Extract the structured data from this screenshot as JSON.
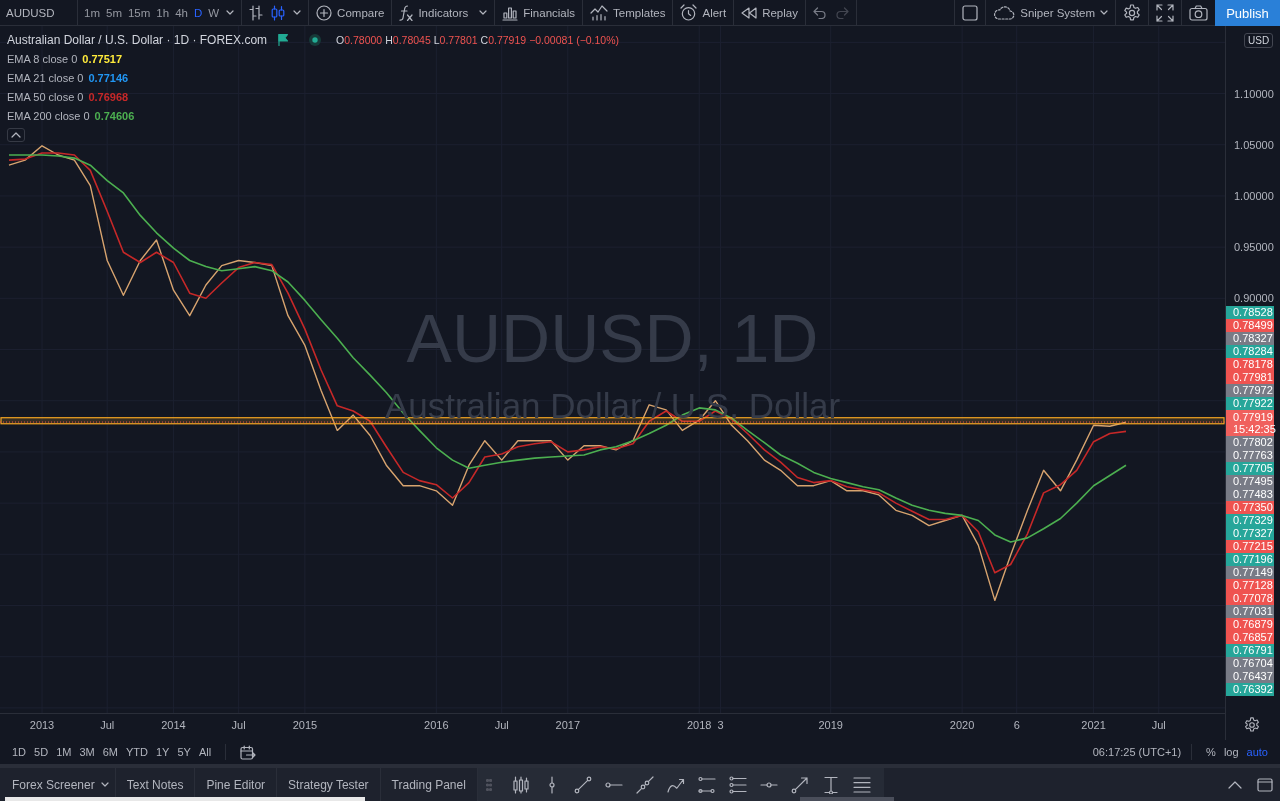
{
  "toolbar": {
    "symbol": "AUDUSD",
    "intervals": [
      {
        "label": "1m",
        "selected": false
      },
      {
        "label": "5m",
        "selected": false
      },
      {
        "label": "15m",
        "selected": false
      },
      {
        "label": "1h",
        "selected": false
      },
      {
        "label": "4h",
        "selected": false
      },
      {
        "label": "D",
        "selected": true
      },
      {
        "label": "W",
        "selected": false
      }
    ],
    "chart_styles": [
      {
        "kind": "bars",
        "selected": false
      },
      {
        "kind": "candles",
        "selected": true
      }
    ],
    "tools": [
      {
        "kind": "compare",
        "label": "Compare",
        "menu": false
      },
      {
        "kind": "indicators",
        "label": "Indicators",
        "menu": true
      },
      {
        "kind": "financials",
        "label": "Financials",
        "menu": false
      },
      {
        "kind": "templates",
        "label": "Templates",
        "menu": false
      },
      {
        "kind": "alert",
        "label": "Alert",
        "menu": false
      },
      {
        "kind": "replay",
        "label": "Replay",
        "menu": false
      }
    ],
    "history": [
      {
        "kind": "undo",
        "disabled": false
      },
      {
        "kind": "redo",
        "disabled": true
      }
    ],
    "layout_name": "Sniper System",
    "publish": "Publish"
  },
  "legend": {
    "title": "Australian Dollar / U.S. Dollar · 1D · FOREX.com",
    "ohlc": [
      {
        "label": "O",
        "value": "0.78000"
      },
      {
        "label": "H",
        "value": "0.78045"
      },
      {
        "label": "L",
        "value": "0.77801"
      },
      {
        "label": "C",
        "value": "0.77919"
      }
    ],
    "change": "−0.00081 (−0.10%)",
    "negative": true,
    "indicators": [
      {
        "label": "EMA 8 close 0",
        "value": "0.77517",
        "color": "#ffeb3b"
      },
      {
        "label": "EMA 21 close 0",
        "value": "0.77146",
        "color": "#2196f3"
      },
      {
        "label": "EMA 50 close 0",
        "value": "0.76968",
        "color": "#c62828"
      },
      {
        "label": "EMA 200 close 0",
        "value": "0.74606",
        "color": "#4caf50"
      }
    ]
  },
  "chart": {
    "watermark": {
      "symbol": "AUDUSD, 1D",
      "description": "Australian Dollar / U.S. Dollar"
    },
    "currency": "USD",
    "chart_data": {
      "type": "line",
      "grid": true,
      "x": [
        "2012-10-01",
        "2012-11-15",
        "2013-01-01",
        "2013-02-15",
        "2013-04-01",
        "2013-05-15",
        "2013-07-01",
        "2013-08-15",
        "2013-10-01",
        "2013-11-15",
        "2014-01-01",
        "2014-02-15",
        "2014-04-01",
        "2014-05-15",
        "2014-07-01",
        "2014-08-15",
        "2014-10-01",
        "2014-11-15",
        "2015-01-01",
        "2015-02-15",
        "2015-04-01",
        "2015-05-15",
        "2015-07-01",
        "2015-08-15",
        "2015-10-01",
        "2015-11-15",
        "2016-01-01",
        "2016-02-15",
        "2016-04-01",
        "2016-05-15",
        "2016-07-01",
        "2016-08-15",
        "2016-10-01",
        "2016-11-15",
        "2017-01-01",
        "2017-02-15",
        "2017-04-01",
        "2017-05-15",
        "2017-07-01",
        "2017-08-15",
        "2017-10-01",
        "2017-11-15",
        "2018-01-01",
        "2018-02-15",
        "2018-04-01",
        "2018-05-15",
        "2018-07-01",
        "2018-08-15",
        "2018-10-01",
        "2018-11-15",
        "2019-01-01",
        "2019-02-15",
        "2019-04-01",
        "2019-05-15",
        "2019-07-01",
        "2019-08-15",
        "2019-10-01",
        "2019-11-15",
        "2020-01-01",
        "2020-02-15",
        "2020-04-01",
        "2020-05-15",
        "2020-07-01",
        "2020-08-15",
        "2020-10-01",
        "2020-11-15",
        "2021-01-01",
        "2021-02-15",
        "2021-04-01"
      ],
      "xlim": [
        "2012-09-06",
        "2022-01-01"
      ],
      "ylim": [
        0.495,
        1.166
      ],
      "xticks": [
        {
          "value": "2013-01-01",
          "label": "2013"
        },
        {
          "value": "2013-07-01",
          "label": "Jul"
        },
        {
          "value": "2014-01-01",
          "label": "2014"
        },
        {
          "value": "2014-07-01",
          "label": "Jul"
        },
        {
          "value": "2015-01-01",
          "label": "2015"
        },
        {
          "value": "2016-01-01",
          "label": "2016"
        },
        {
          "value": "2016-07-01",
          "label": "Jul"
        },
        {
          "value": "2017-01-01",
          "label": "2017"
        },
        {
          "value": "2018-01-01",
          "label": "2018"
        },
        {
          "value": "2018-03-01",
          "label": "3"
        },
        {
          "value": "2019-01-01",
          "label": "2019"
        },
        {
          "value": "2020-01-01",
          "label": "2020"
        },
        {
          "value": "2020-06-01",
          "label": "6"
        },
        {
          "value": "2021-01-01",
          "label": "2021"
        },
        {
          "value": "2021-07-01",
          "label": "Jul"
        }
      ],
      "yticks": [
        {
          "value": 0.9,
          "label": "0.90000"
        },
        {
          "value": 0.95,
          "label": "0.95000"
        },
        {
          "value": 1.0,
          "label": "1.00000"
        },
        {
          "value": 1.05,
          "label": "1.05000"
        },
        {
          "value": 1.1,
          "label": "1.10000"
        }
      ],
      "series": [
        {
          "color": "#d8a46f",
          "values": [
            1.03,
            1.035,
            1.049,
            1.04,
            1.035,
            1.01,
            0.937,
            0.903,
            0.937,
            0.957,
            0.908,
            0.883,
            0.913,
            0.932,
            0.937,
            0.935,
            0.932,
            0.883,
            0.854,
            0.81,
            0.771,
            0.786,
            0.766,
            0.737,
            0.717,
            0.717,
            0.712,
            0.698,
            0.737,
            0.761,
            0.742,
            0.761,
            0.761,
            0.761,
            0.742,
            0.756,
            0.756,
            0.752,
            0.761,
            0.796,
            0.791,
            0.771,
            0.781,
            0.8,
            0.776,
            0.761,
            0.742,
            0.732,
            0.717,
            0.717,
            0.722,
            0.712,
            0.712,
            0.708,
            0.693,
            0.688,
            0.678,
            0.683,
            0.688,
            0.659,
            0.605,
            0.649,
            0.693,
            0.732,
            0.712,
            0.742,
            0.776,
            0.775,
            0.779
          ]
        },
        {
          "color": "#c62828",
          "values": [
            1.035,
            1.036,
            1.042,
            1.042,
            1.04,
            1.025,
            0.985,
            0.945,
            0.935,
            0.945,
            0.935,
            0.905,
            0.9,
            0.915,
            0.93,
            0.935,
            0.933,
            0.905,
            0.87,
            0.83,
            0.795,
            0.79,
            0.78,
            0.755,
            0.73,
            0.722,
            0.718,
            0.705,
            0.72,
            0.745,
            0.748,
            0.755,
            0.758,
            0.76,
            0.75,
            0.752,
            0.755,
            0.753,
            0.758,
            0.78,
            0.79,
            0.78,
            0.78,
            0.79,
            0.782,
            0.768,
            0.752,
            0.74,
            0.725,
            0.72,
            0.722,
            0.716,
            0.713,
            0.71,
            0.7,
            0.692,
            0.684,
            0.684,
            0.688,
            0.672,
            0.632,
            0.64,
            0.67,
            0.71,
            0.718,
            0.732,
            0.76,
            0.768,
            0.77
          ]
        },
        {
          "color": "#4caf50",
          "values": [
            1.04,
            1.04,
            1.04,
            1.039,
            1.037,
            1.03,
            1.015,
            1.003,
            0.981,
            0.964,
            0.949,
            0.937,
            0.931,
            0.927,
            0.929,
            0.931,
            0.927,
            0.916,
            0.898,
            0.879,
            0.861,
            0.842,
            0.825,
            0.808,
            0.788,
            0.771,
            0.754,
            0.742,
            0.734,
            0.737,
            0.74,
            0.742,
            0.744,
            0.745,
            0.746,
            0.747,
            0.752,
            0.755,
            0.761,
            0.768,
            0.776,
            0.786,
            0.793,
            0.791,
            0.783,
            0.771,
            0.759,
            0.747,
            0.739,
            0.73,
            0.724,
            0.72,
            0.716,
            0.713,
            0.705,
            0.698,
            0.693,
            0.69,
            0.688,
            0.683,
            0.669,
            0.662,
            0.666,
            0.675,
            0.685,
            0.7,
            0.717,
            0.727,
            0.737
          ]
        }
      ],
      "bands": [
        {
          "axis": "y",
          "from": 0.7775,
          "to": 0.7834,
          "color": "#f5a623"
        }
      ],
      "ref_lines": [
        {
          "axis": "y",
          "value": 0.77919,
          "color": "#ef5350"
        }
      ]
    },
    "price_labels": [
      {
        "kind": "level",
        "value": "0.78528",
        "color": "#26a69a"
      },
      {
        "kind": "level",
        "value": "0.78499",
        "color": "#ef5350"
      },
      {
        "kind": "level",
        "value": "0.78327",
        "color": "#787b86"
      },
      {
        "kind": "level",
        "value": "0.78284",
        "color": "#26a69a"
      },
      {
        "kind": "level",
        "value": "0.78178",
        "color": "#ef5350"
      },
      {
        "kind": "level",
        "value": "0.77981",
        "color": "#ef5350"
      },
      {
        "kind": "level",
        "value": "0.77972",
        "color": "#787b86"
      },
      {
        "kind": "level",
        "value": "0.77922",
        "color": "#26a69a"
      },
      {
        "kind": "last",
        "value": "0.77919",
        "countdown": "15:42:35",
        "color": "#f0605d"
      },
      {
        "kind": "level",
        "value": "0.77802",
        "color": "#787b86"
      },
      {
        "kind": "level",
        "value": "0.77763",
        "color": "#787b86"
      },
      {
        "kind": "level",
        "value": "0.77705",
        "color": "#26a69a"
      },
      {
        "kind": "level",
        "value": "0.77495",
        "color": "#787b86"
      },
      {
        "kind": "level",
        "value": "0.77483",
        "color": "#787b86"
      },
      {
        "kind": "level",
        "value": "0.77350",
        "color": "#ef5350"
      },
      {
        "kind": "level",
        "value": "0.77329",
        "color": "#26a69a"
      },
      {
        "kind": "level",
        "value": "0.77327",
        "color": "#26a69a"
      },
      {
        "kind": "level",
        "value": "0.77215",
        "color": "#ef5350"
      },
      {
        "kind": "level",
        "value": "0.77196",
        "color": "#26a69a"
      },
      {
        "kind": "level",
        "value": "0.77149",
        "color": "#787b86"
      },
      {
        "kind": "level",
        "value": "0.77128",
        "color": "#ef5350"
      },
      {
        "kind": "level",
        "value": "0.77078",
        "color": "#ef5350"
      },
      {
        "kind": "level",
        "value": "0.77031",
        "color": "#787b86"
      },
      {
        "kind": "level",
        "value": "0.76879",
        "color": "#ef5350"
      },
      {
        "kind": "level",
        "value": "0.76857",
        "color": "#ef5350"
      },
      {
        "kind": "level",
        "value": "0.76791",
        "color": "#26a69a"
      },
      {
        "kind": "level",
        "value": "0.76704",
        "color": "#787b86"
      },
      {
        "kind": "level",
        "value": "0.76437",
        "color": "#787b86"
      },
      {
        "kind": "level",
        "value": "0.76392",
        "color": "#26a69a"
      }
    ]
  },
  "range_bar": {
    "ranges": [
      "1D",
      "5D",
      "1M",
      "3M",
      "6M",
      "YTD",
      "1Y",
      "5Y",
      "All"
    ],
    "clock": "06:17:25 (UTC+1)",
    "scale_modes": [
      {
        "label": "%",
        "selected": false
      },
      {
        "label": "log",
        "selected": false
      },
      {
        "label": "auto",
        "selected": true
      }
    ]
  },
  "bottom_panel": {
    "tabs": [
      {
        "label": "Forex Screener",
        "menu": true
      },
      {
        "label": "Text Notes",
        "menu": false
      },
      {
        "label": "Pine Editor",
        "menu": false
      },
      {
        "label": "Strategy Tester",
        "menu": false
      },
      {
        "label": "Trading Panel",
        "menu": false
      }
    ]
  }
}
